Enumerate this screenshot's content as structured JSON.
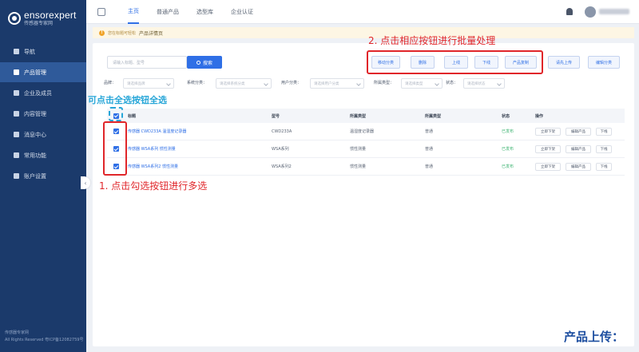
{
  "sidebar": {
    "logo_en": "ensorexpert",
    "logo_cn": "传感器专家网",
    "items": [
      {
        "label": "导航",
        "icon": "home-icon",
        "active": false
      },
      {
        "label": "产品管理",
        "icon": "product-icon",
        "active": true
      },
      {
        "label": "企业及成员",
        "icon": "company-icon",
        "active": false
      },
      {
        "label": "内容管理",
        "icon": "content-icon",
        "active": false
      },
      {
        "label": "消息中心",
        "icon": "message-icon",
        "active": false
      },
      {
        "label": "常用功能",
        "icon": "function-icon",
        "active": false
      },
      {
        "label": "账户设置",
        "icon": "account-icon",
        "active": false
      }
    ],
    "footer_line1": "传感器专家网",
    "footer_line2": "All Rights Reserved 粤ICP备12082759号"
  },
  "topbar": {
    "tabs": [
      {
        "label": "主页",
        "active": true
      },
      {
        "label": "普通产品",
        "active": false
      },
      {
        "label": "选型库",
        "active": false
      },
      {
        "label": "企业认证",
        "active": false
      }
    ]
  },
  "notice": {
    "small_text": "您在标题可轻松",
    "main_text": "产品详情页"
  },
  "search": {
    "placeholder": "请输入标题、型号",
    "button_label": "搜索"
  },
  "batch_buttons": [
    "移动分类",
    "删除",
    "上线",
    "下线",
    "产品复制",
    "请先上传",
    "编辑分类"
  ],
  "filters": [
    {
      "label": "品牌：",
      "placeholder": "请选择品牌"
    },
    {
      "label": "系统分类：",
      "placeholder": "请选择系统分类"
    },
    {
      "label": "用户分类：",
      "placeholder": "请选择用户分类"
    },
    {
      "label": "所属类型：",
      "placeholder": "请选择类型"
    },
    {
      "label": "状态：",
      "placeholder": "请选择状态"
    }
  ],
  "table": {
    "headers": [
      "标题",
      "型号",
      "所属类型",
      "所属类型",
      "状态",
      "操作"
    ],
    "rows": [
      {
        "title": "传感器 CWD233A 温湿度记录器",
        "model": "CWD233A",
        "type1": "温湿度记录器",
        "type2": "普通",
        "status": "已发布",
        "ops": [
          "立即下架",
          "编辑产品",
          "下线"
        ]
      },
      {
        "title": "传感器 WSA系列 惯性测量",
        "model": "WSA系列",
        "type1": "惯性测量",
        "type2": "普通",
        "status": "已发布",
        "ops": [
          "立即下架",
          "编辑产品",
          "下线"
        ]
      },
      {
        "title": "传感器 WSA系列2 惯性测量",
        "model": "WSA系列2",
        "type1": "惯性测量",
        "type2": "普通",
        "status": "已发布",
        "ops": [
          "立即下架",
          "编辑产品",
          "下线"
        ]
      }
    ]
  },
  "annotations": {
    "batch": "2. 点击相应按钮进行批量处理",
    "select_all": "可点击全选按钮全选",
    "multi_select": "1. 点击勾选按钮进行多选"
  },
  "caption": "产品上传：",
  "colors": {
    "sidebar": "#1b3a6b",
    "accent": "#2f6fe6",
    "annotation_red": "#e0262a",
    "annotation_blue": "#27a6d8",
    "status_green": "#3cb371"
  }
}
